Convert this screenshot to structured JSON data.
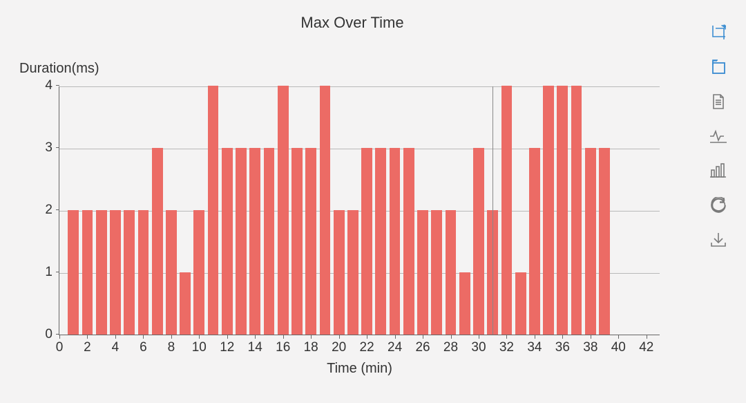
{
  "chart_data": {
    "type": "bar",
    "title": "Max Over Time",
    "xlabel": "Time (min)",
    "ylabel": "Duration(ms)",
    "xlim": [
      0,
      43
    ],
    "ylim": [
      0,
      4
    ],
    "xticks": [
      0,
      2,
      4,
      6,
      8,
      10,
      12,
      14,
      16,
      18,
      20,
      22,
      24,
      26,
      28,
      30,
      32,
      34,
      36,
      38,
      40,
      42
    ],
    "yticks": [
      0,
      1,
      2,
      3,
      4
    ],
    "categories": [
      1,
      2,
      3,
      4,
      5,
      6,
      7,
      8,
      9,
      10,
      11,
      12,
      13,
      14,
      15,
      16,
      17,
      18,
      19,
      20,
      21,
      22,
      23,
      24,
      25,
      26,
      27,
      28,
      29,
      30,
      31,
      32,
      33,
      34,
      35,
      36,
      37,
      38,
      39
    ],
    "values": [
      2,
      2,
      2,
      2,
      2,
      2,
      3,
      2,
      1,
      2,
      4,
      3,
      3,
      3,
      3,
      4,
      3,
      3,
      4,
      2,
      2,
      3,
      3,
      3,
      3,
      2,
      2,
      2,
      1,
      3,
      2,
      4,
      1,
      3,
      4,
      4,
      4,
      3,
      3
    ],
    "bar_color": "#ec6b65",
    "cursor_x": 31
  },
  "toolbar": {
    "items": [
      {
        "name": "crop-icon",
        "label": "Crop"
      },
      {
        "name": "reset-zoom-icon",
        "label": "Reset Zoom"
      },
      {
        "name": "document-icon",
        "label": "View Data"
      },
      {
        "name": "activity-icon",
        "label": "Line View"
      },
      {
        "name": "bar-chart-icon",
        "label": "Bar View"
      },
      {
        "name": "refresh-icon",
        "label": "Refresh"
      },
      {
        "name": "download-icon",
        "label": "Download"
      }
    ]
  }
}
